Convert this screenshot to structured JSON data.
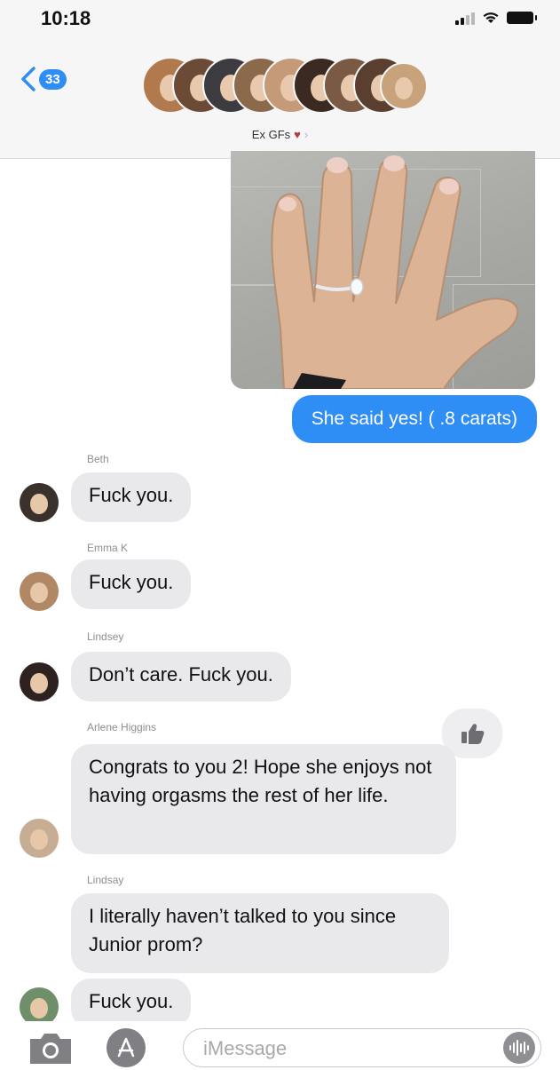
{
  "status_bar": {
    "time": "10:18"
  },
  "header": {
    "unread_count": "33",
    "group_name": "Ex GFs",
    "heart_glyph": "♥",
    "chevron_glyph": "›"
  },
  "messages": {
    "outgoing_text": "She said yes! ( .8 carats)",
    "m1": {
      "sender": "Beth",
      "text": "Fuck you."
    },
    "m2": {
      "sender": "Emma K",
      "text": "Fuck you."
    },
    "m3": {
      "sender": "Lindsey",
      "text": "Don’t care. Fuck you."
    },
    "m4": {
      "sender": "Arlene Higgins",
      "text": "Congrats to you 2! Hope she enjoys not having orgasms the rest of her life."
    },
    "m5": {
      "sender": "Lindsay",
      "text": "I literally haven’t talked to you since Junior prom?"
    },
    "m6": {
      "text": "Fuck you."
    }
  },
  "composer": {
    "placeholder": "iMessage"
  },
  "icons": {
    "back": "chevron-left-icon",
    "camera": "camera-icon",
    "apps": "app-store-icon",
    "audio": "audio-waveform-icon",
    "tapback": "thumbs-up-icon"
  },
  "colors": {
    "accent": "#2f8df6",
    "incoming_bubble": "#e9e9eb",
    "header_bg": "#f6f6f7"
  }
}
